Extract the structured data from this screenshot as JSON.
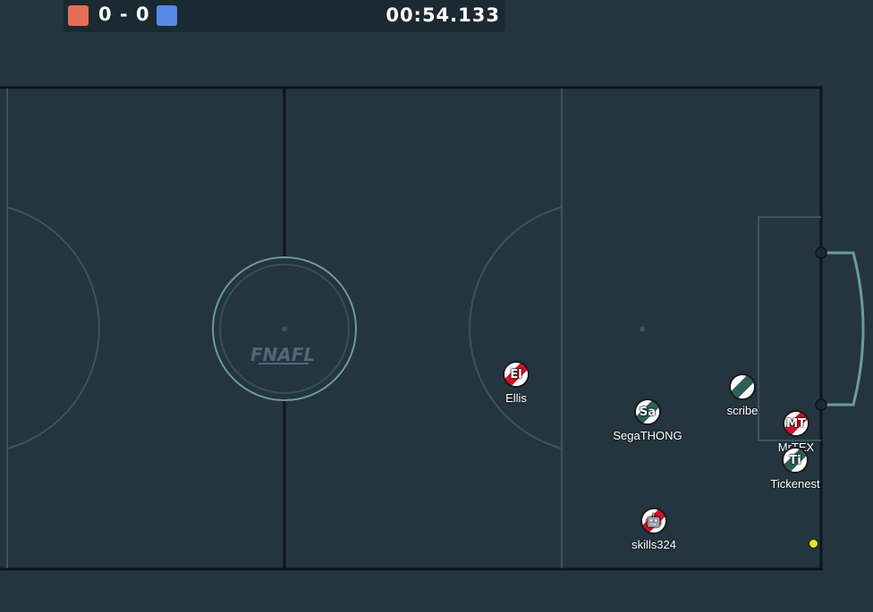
{
  "scoreboard": {
    "red_color": "#e56e56",
    "blue_color": "#5689e5",
    "score": "0 - 0",
    "time": "00:54.133"
  },
  "field": {
    "logo": "FNAFL",
    "background": "#243540",
    "line_color": "#3c5260"
  },
  "players": [
    {
      "name": "Ellis",
      "avatar": "El",
      "team": "red"
    },
    {
      "name": "SegaTHONG",
      "avatar": "Sa",
      "team": "teal"
    },
    {
      "name": "scribe",
      "avatar": "",
      "team": "teal"
    },
    {
      "name": "MrTEX",
      "avatar": "MT",
      "team": "red"
    },
    {
      "name": "Tickenest",
      "avatar": "Ti",
      "team": "teal"
    },
    {
      "name": "skills324",
      "avatar": "🤖",
      "team": "red"
    }
  ],
  "ball_color": "#e6e02b"
}
